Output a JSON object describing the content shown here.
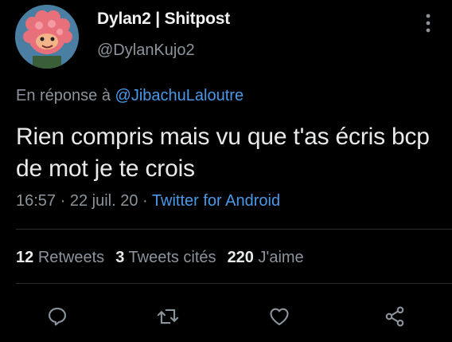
{
  "author": {
    "display_name": "Dylan2 | Shitpost",
    "handle": "@DylanKujo2",
    "avatar_icon": "avatar-image"
  },
  "reply_context": {
    "prefix": "En réponse à",
    "mention": "@JibachuLaloutre"
  },
  "tweet": {
    "text": "Rien compris mais vu que t'as écris bcp de mot je te crois",
    "time": "16:57",
    "separator": "·",
    "date": "22 juil. 20",
    "source": "Twitter for Android"
  },
  "stats": {
    "retweets_count": "12",
    "retweets_label": "Retweets",
    "quotes_count": "3",
    "quotes_label": "Tweets cités",
    "likes_count": "220",
    "likes_label": "J'aime"
  },
  "actions": [
    {
      "name": "reply",
      "icon": "speech-bubble-icon"
    },
    {
      "name": "retweet",
      "icon": "retweet-icon"
    },
    {
      "name": "like",
      "icon": "heart-icon"
    },
    {
      "name": "share",
      "icon": "share-icon"
    }
  ],
  "colors": {
    "background": "#000000",
    "primary_text": "#e7e9ea",
    "secondary_text": "#8b949c",
    "link": "#4a99e9",
    "divider": "#2a2d30"
  }
}
